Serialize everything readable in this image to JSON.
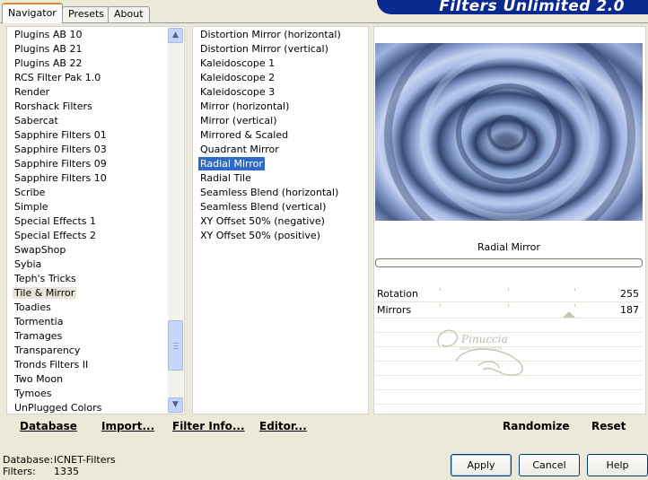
{
  "window": {
    "title": "Filters Unlimited 2.0",
    "tabs": [
      "Navigator",
      "Presets",
      "About"
    ],
    "active_tab": "Navigator"
  },
  "categories": {
    "items": [
      "Plugins AB 10",
      "Plugins AB 21",
      "Plugins AB 22",
      "RCS Filter Pak 1.0",
      "Render",
      "Rorshack Filters",
      "Sabercat",
      "Sapphire Filters 01",
      "Sapphire Filters 03",
      "Sapphire Filters 09",
      "Sapphire Filters 10",
      "Scribe",
      "Simple",
      "Special Effects 1",
      "Special Effects 2",
      "SwapShop",
      "Sybia",
      "Teph's Tricks",
      "Tile & Mirror",
      "Toadies",
      "Tormentia",
      "Tramages",
      "Transparency",
      "Tronds Filters II",
      "Two Moon",
      "Tymoes",
      "UnPlugged Colors"
    ],
    "selected": "Tile & Mirror"
  },
  "filters": {
    "items": [
      "Distortion Mirror (horizontal)",
      "Distortion Mirror (vertical)",
      "Kaleidoscope 1",
      "Kaleidoscope 2",
      "Kaleidoscope 3",
      "Mirror (horizontal)",
      "Mirror (vertical)",
      "Mirrored & Scaled",
      "Quadrant Mirror",
      "Radial Mirror",
      "Radial Tile",
      "Seamless Blend (horizontal)",
      "Seamless Blend (vertical)",
      "XY Offset 50% (negative)",
      "XY Offset 50% (positive)"
    ],
    "selected": "Radial Mirror"
  },
  "effect": {
    "name": "Radial Mirror",
    "progress_percent": 0,
    "params": [
      {
        "label": "Rotation",
        "value": "255"
      },
      {
        "label": "Mirrors",
        "value": "187"
      }
    ]
  },
  "toolbar": {
    "database": "Database",
    "import": "Import...",
    "filter_info": "Filter Info...",
    "editor": "Editor...",
    "randomize": "Randomize",
    "reset": "Reset"
  },
  "status": {
    "database_label": "Database:",
    "database_value": "ICNET-Filters",
    "filters_label": "Filters:",
    "filters_value": "1335"
  },
  "buttons": {
    "apply": "Apply",
    "cancel": "Cancel",
    "help": "Help"
  },
  "watermark": {
    "name": "Pinuccia",
    "url": "www.medirattoo.rs"
  },
  "colors": {
    "title_bar": "#0b2a8f",
    "selection": "#316ac5",
    "window_bg": "#ece9d8"
  }
}
